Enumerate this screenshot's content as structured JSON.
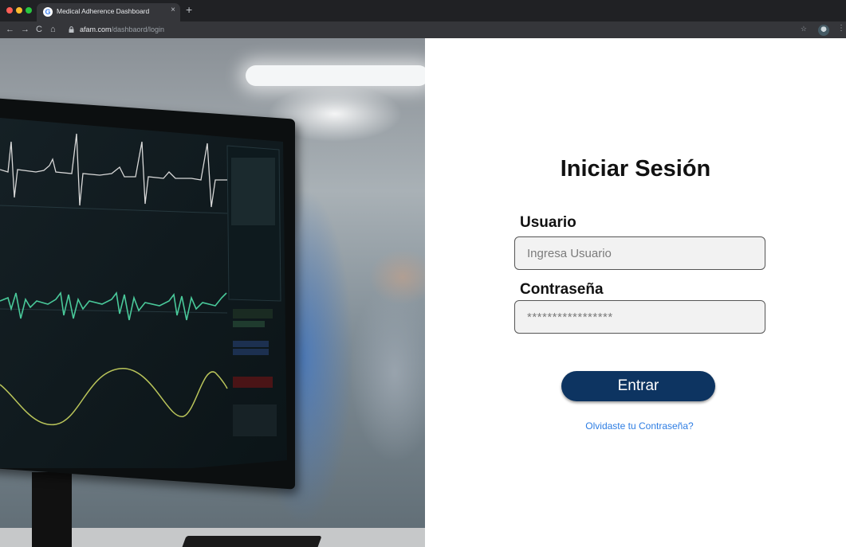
{
  "browser": {
    "tab_title": "Medical Adherence Dashboard",
    "tab_close": "×",
    "new_tab": "+",
    "url_host": "afam.com",
    "url_path": "/dashbaord/login",
    "nav": {
      "back": "←",
      "forward": "→",
      "reload": "C",
      "home": "⌂"
    },
    "star": "☆",
    "menu": "⋮"
  },
  "hero": {
    "image_subject": "patient-monitor-hospital-room"
  },
  "login": {
    "title": "Iniciar Sesión",
    "username_label": "Usuario",
    "username_placeholder": "Ingresa Usuario",
    "password_label": "Contraseña",
    "password_value": "*****************",
    "submit_label": "Entrar",
    "forgot_label": "Olvidaste tu Contraseña?"
  },
  "colors": {
    "primary_button": "#0d3461",
    "link": "#2d7de3",
    "ecg_trace": "#d8d8d8",
    "pleth_trace": "#49c99a",
    "resp_trace": "#b9c45a"
  }
}
